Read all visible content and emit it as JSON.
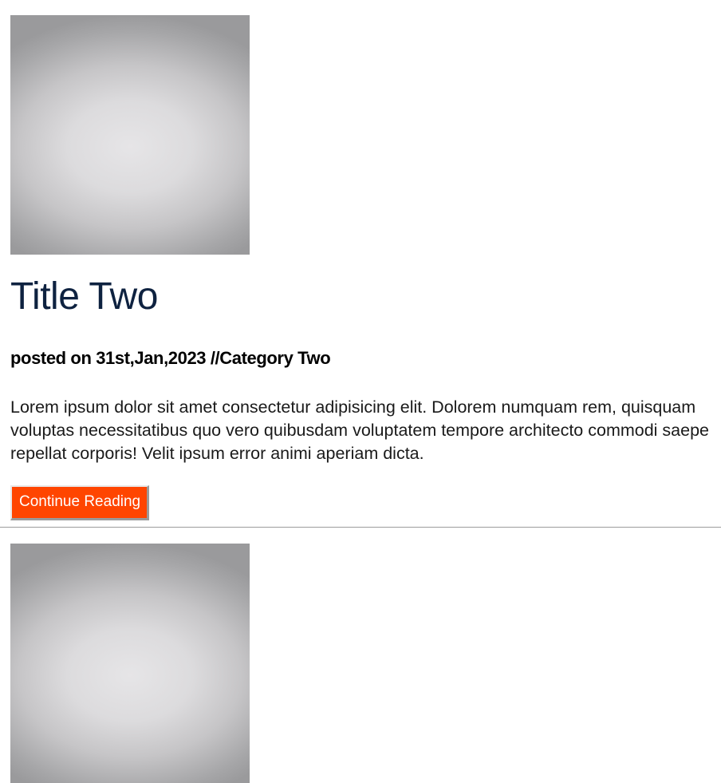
{
  "posts": [
    {
      "image": "post-thumbnail-gray-gradient",
      "title": "Title Two",
      "meta": "posted on 31st,Jan,2023 //Category Two",
      "excerpt": "Lorem ipsum dolor sit amet consectetur adipisicing elit. Dolorem numquam rem, quisquam voluptas necessitatibus quo vero quibusdam voluptatem tempore architecto commodi saepe repellat corporis! Velit ipsum error animi aperiam dicta.",
      "button_label": "Continue Reading"
    },
    {
      "image": "post-thumbnail-gray-gradient"
    }
  ],
  "colors": {
    "title": "#0e2240",
    "button_bg": "#ff4500",
    "button_text": "#ffffff",
    "divider": "#9c9c9c"
  }
}
